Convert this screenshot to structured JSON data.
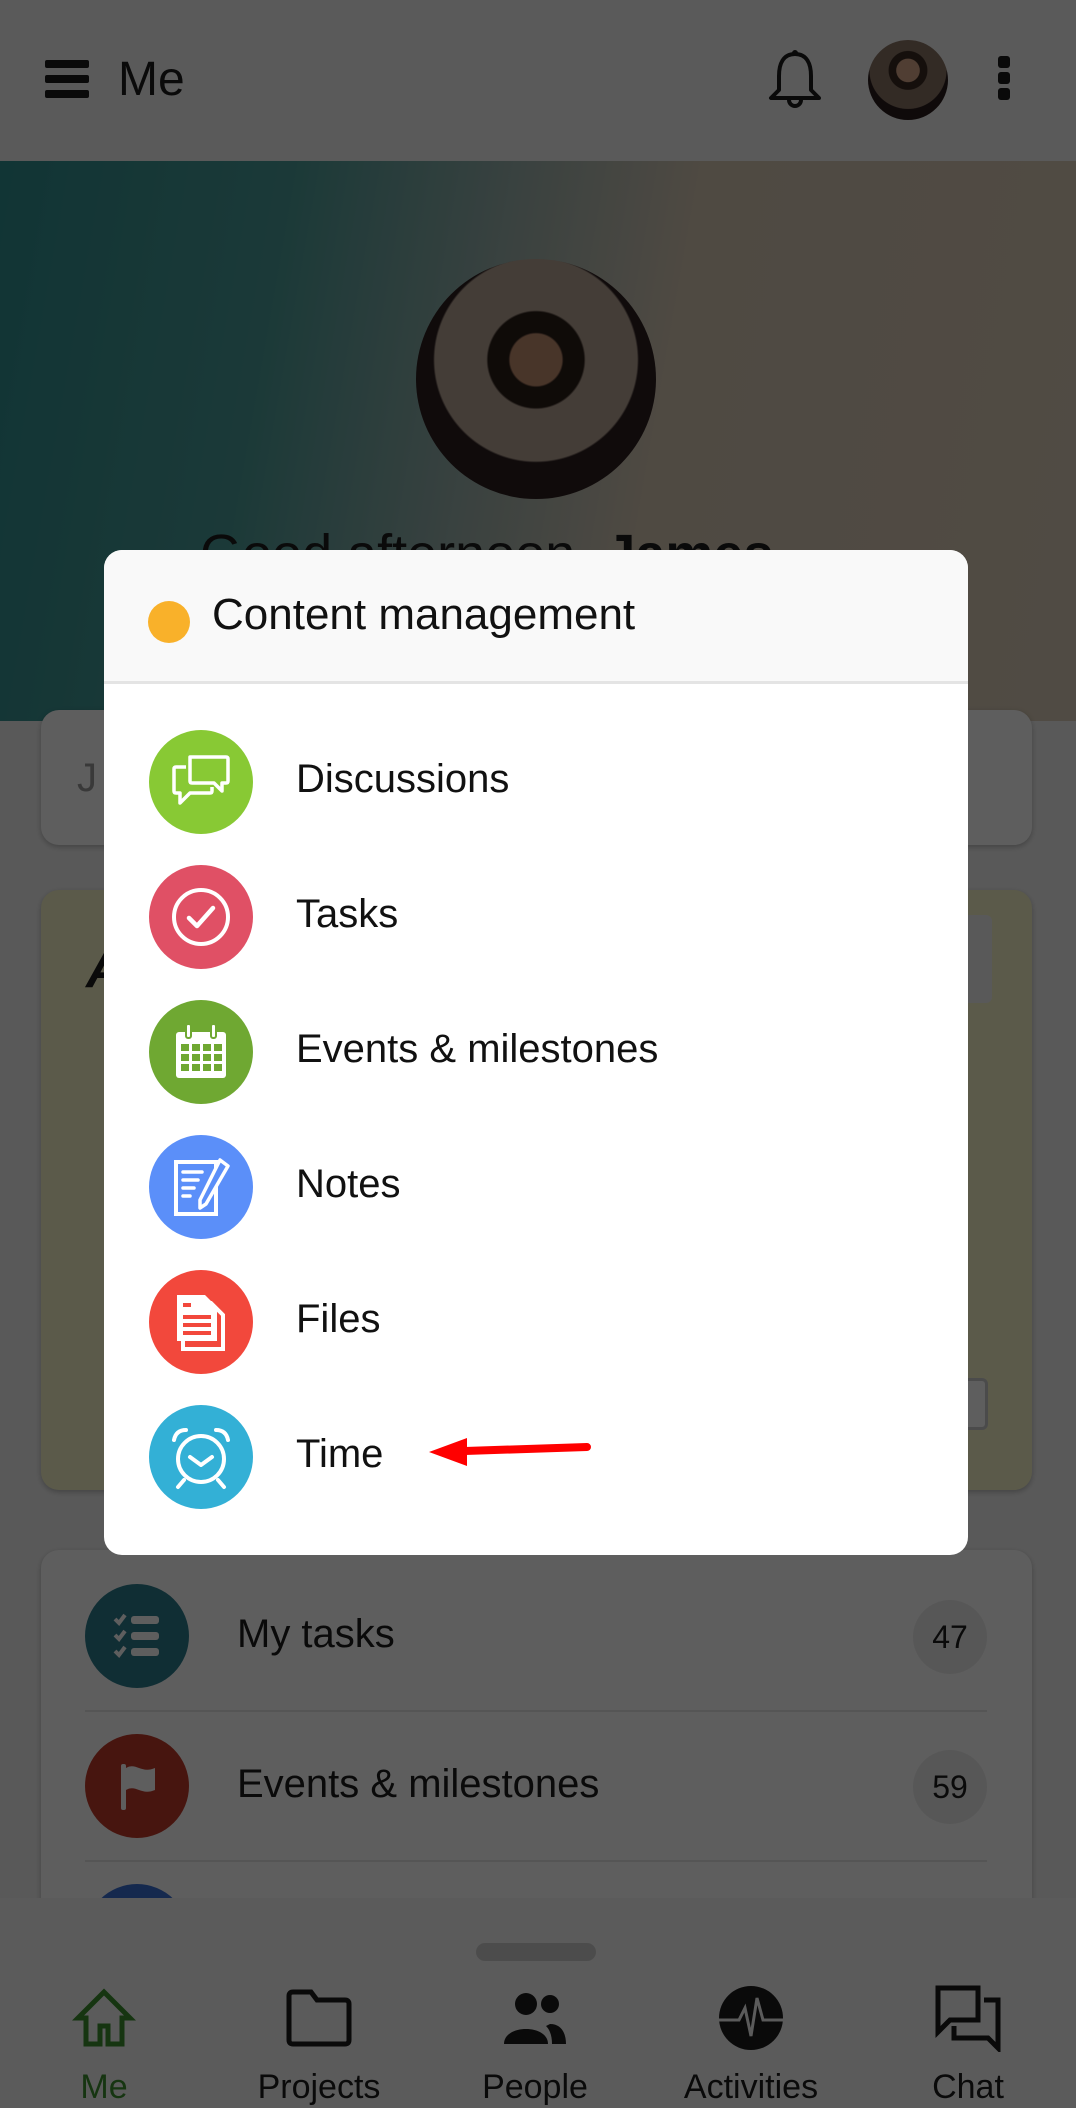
{
  "topbar": {
    "title": "Me"
  },
  "hero": {
    "greeting_prefix": "Good afternoon, ",
    "greeting_name": "James"
  },
  "background": {
    "search_placeholder_partial": "J",
    "yellow_card_title_partial": "A",
    "list": [
      {
        "label": "My tasks",
        "count": "47",
        "icon": "checklist-icon",
        "color": "#2d7c8e"
      },
      {
        "label": "Events & milestones",
        "count": "59",
        "icon": "flag-icon",
        "color": "#c0392b"
      }
    ]
  },
  "modal": {
    "title": "Content management",
    "dot_color": "#f9b12a",
    "items": [
      {
        "label": "Discussions",
        "icon": "discussions-icon",
        "color": "#88c934"
      },
      {
        "label": "Tasks",
        "icon": "tasks-check-icon",
        "color": "#e05065"
      },
      {
        "label": "Events & milestones",
        "icon": "calendar-icon",
        "color": "#6fa832"
      },
      {
        "label": "Notes",
        "icon": "notes-icon",
        "color": "#5b8ff9"
      },
      {
        "label": "Files",
        "icon": "files-icon",
        "color": "#f2483c"
      },
      {
        "label": "Time",
        "icon": "alarm-clock-icon",
        "color": "#33b0d6"
      }
    ]
  },
  "annotation": {
    "color": "#ff0000",
    "target": "Time"
  },
  "bottom_nav": [
    {
      "label": "Me",
      "icon": "home-icon",
      "active": true
    },
    {
      "label": "Projects",
      "icon": "folder-icon",
      "active": false
    },
    {
      "label": "People",
      "icon": "people-icon",
      "active": false
    },
    {
      "label": "Activities",
      "icon": "activity-icon",
      "active": false
    },
    {
      "label": "Chat",
      "icon": "chat-icon",
      "active": false
    }
  ]
}
